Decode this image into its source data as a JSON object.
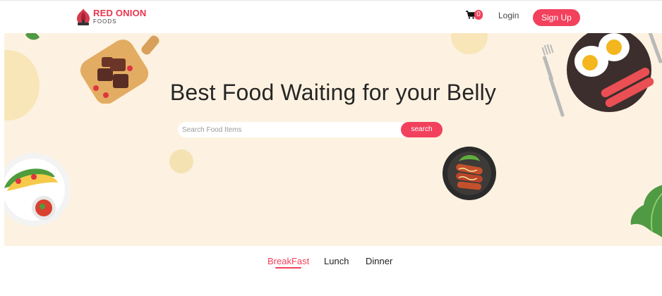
{
  "brand": {
    "name_red": "RED",
    "name_dark": "ONION",
    "sub": "FOODS",
    "color": "#e8344e"
  },
  "navbar": {
    "cart_icon": "cart-icon",
    "cart_count": "0",
    "login_label": "Login",
    "signup_label": "Sign Up"
  },
  "hero": {
    "title": "Best Food Waiting for your Belly",
    "background": "#fdf2e1",
    "search": {
      "placeholder": "Search Food Items",
      "value": "",
      "button_label": "search"
    }
  },
  "tabs": [
    {
      "label": "BreakFast",
      "active": true
    },
    {
      "label": "Lunch",
      "active": false
    },
    {
      "label": "Dinner",
      "active": false
    }
  ],
  "colors": {
    "accent": "#f2415d"
  }
}
